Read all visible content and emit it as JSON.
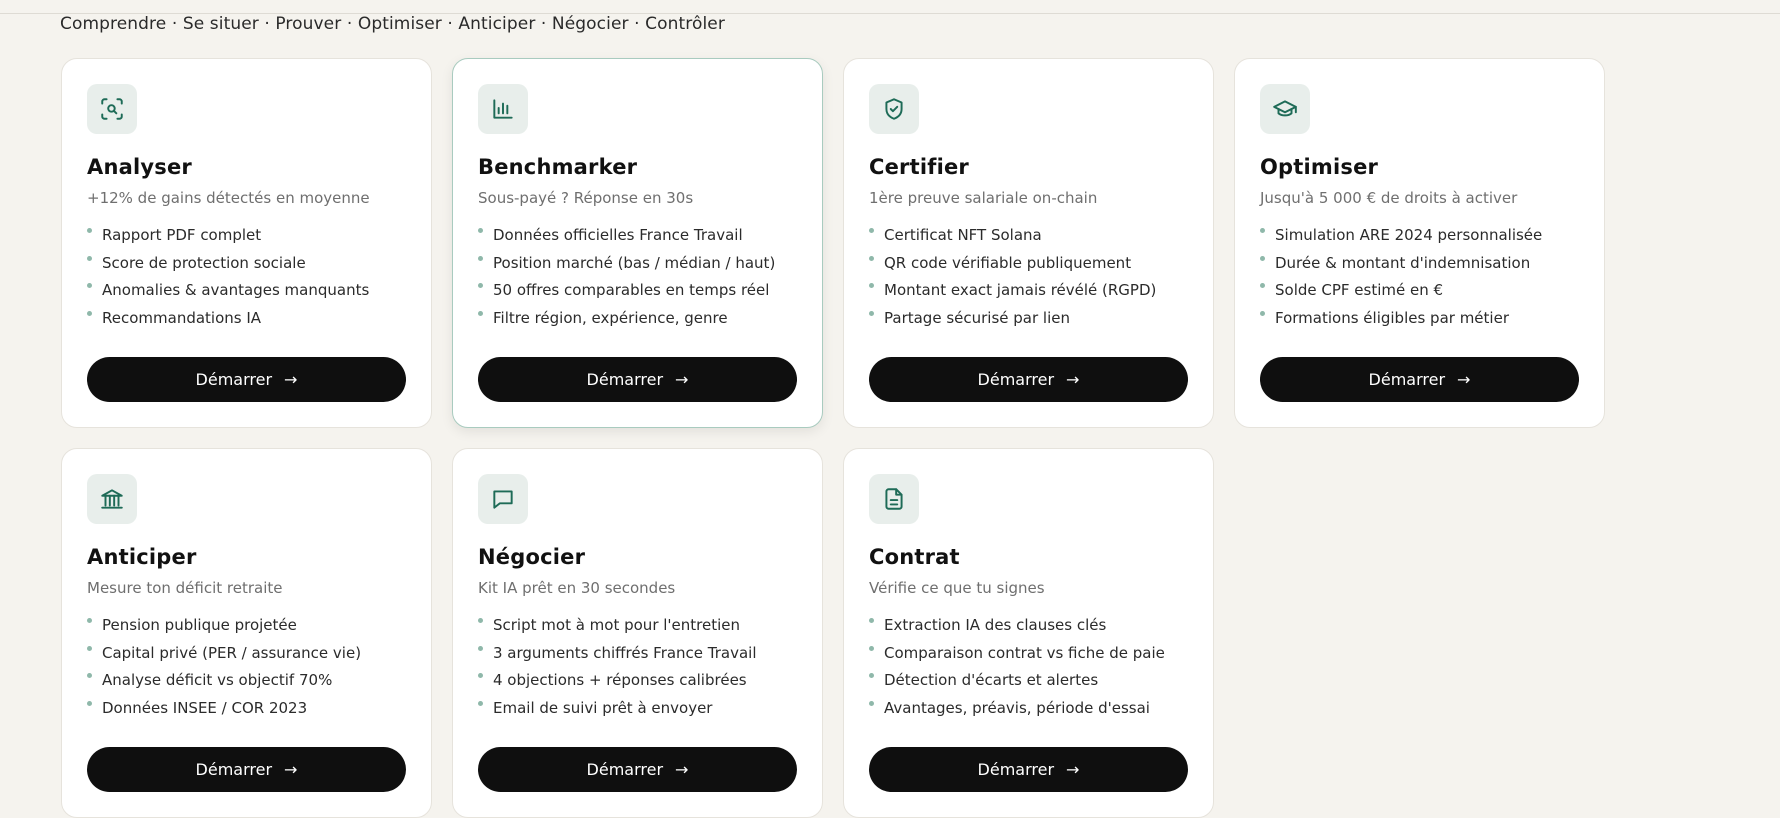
{
  "tagline": "Comprendre · Se situer · Prouver · Optimiser · Anticiper · Négocier · Contrôler",
  "colors": {
    "accent": "#1e6b57",
    "icon_tile": "#e8eeeb",
    "button": "#0f0f0f",
    "background": "#f5f3ee"
  },
  "cards": [
    {
      "title": "Analyser",
      "subtitle": "+12% de gains détectés en moyenne",
      "icon": "scan-search-icon",
      "features": [
        "Rapport PDF complet",
        "Score de protection sociale",
        "Anomalies & avantages manquants",
        "Recommandations IA"
      ],
      "cta": "Démarrer"
    },
    {
      "title": "Benchmarker",
      "subtitle": "Sous-payé ? Réponse en 30s",
      "icon": "bar-chart-icon",
      "features": [
        "Données officielles France Travail",
        "Position marché (bas / médian / haut)",
        "50 offres comparables en temps réel",
        "Filtre région, expérience, genre"
      ],
      "cta": "Démarrer"
    },
    {
      "title": "Certifier",
      "subtitle": "1ère preuve salariale on-chain",
      "icon": "shield-check-icon",
      "features": [
        "Certificat NFT Solana",
        "QR code vérifiable publiquement",
        "Montant exact jamais révélé (RGPD)",
        "Partage sécurisé par lien"
      ],
      "cta": "Démarrer"
    },
    {
      "title": "Optimiser",
      "subtitle": "Jusqu'à 5 000 € de droits à activer",
      "icon": "graduation-cap-icon",
      "features": [
        "Simulation ARE 2024 personnalisée",
        "Durée & montant d'indemnisation",
        "Solde CPF estimé en €",
        "Formations éligibles par métier"
      ],
      "cta": "Démarrer"
    },
    {
      "title": "Anticiper",
      "subtitle": "Mesure ton déficit retraite",
      "icon": "bank-icon",
      "features": [
        "Pension publique projetée",
        "Capital privé (PER / assurance vie)",
        "Analyse déficit vs objectif 70%",
        "Données INSEE / COR 2023"
      ],
      "cta": "Démarrer"
    },
    {
      "title": "Négocier",
      "subtitle": "Kit IA prêt en 30 secondes",
      "icon": "message-square-icon",
      "features": [
        "Script mot à mot pour l'entretien",
        "3 arguments chiffrés France Travail",
        "4 objections + réponses calibrées",
        "Email de suivi prêt à envoyer"
      ],
      "cta": "Démarrer"
    },
    {
      "title": "Contrat",
      "subtitle": "Vérifie ce que tu signes",
      "icon": "file-text-icon",
      "features": [
        "Extraction IA des clauses clés",
        "Comparaison contrat vs fiche de paie",
        "Détection d'écarts et alertes",
        "Avantages, préavis, période d'essai"
      ],
      "cta": "Démarrer"
    }
  ]
}
